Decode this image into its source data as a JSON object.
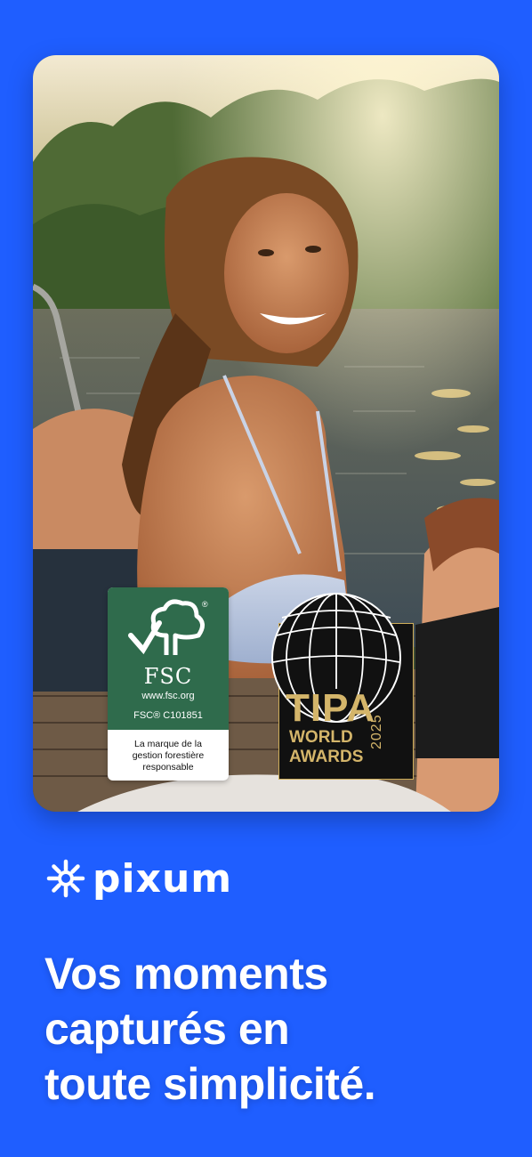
{
  "photo": {
    "subject": "smiling-girl-on-dock-photo"
  },
  "fsc_badge": {
    "name": "FSC",
    "url": "www.fsc.org",
    "code": "FSC® C101851",
    "description": [
      "La marque de la",
      "gestion forestière",
      "responsable"
    ],
    "color": "#2f6b4c"
  },
  "tipa_badge": {
    "title": "TIPA",
    "line1": "WORLD",
    "line2": "AWARDS",
    "year": "2025",
    "color": "#d4b56a"
  },
  "brand": {
    "name": "pixum",
    "icon": "sun-icon"
  },
  "headline": {
    "lines": [
      "Vos moments",
      "capturés en",
      "toute simplicité."
    ]
  },
  "colors": {
    "background": "#1f5eff",
    "text": "#ffffff"
  }
}
